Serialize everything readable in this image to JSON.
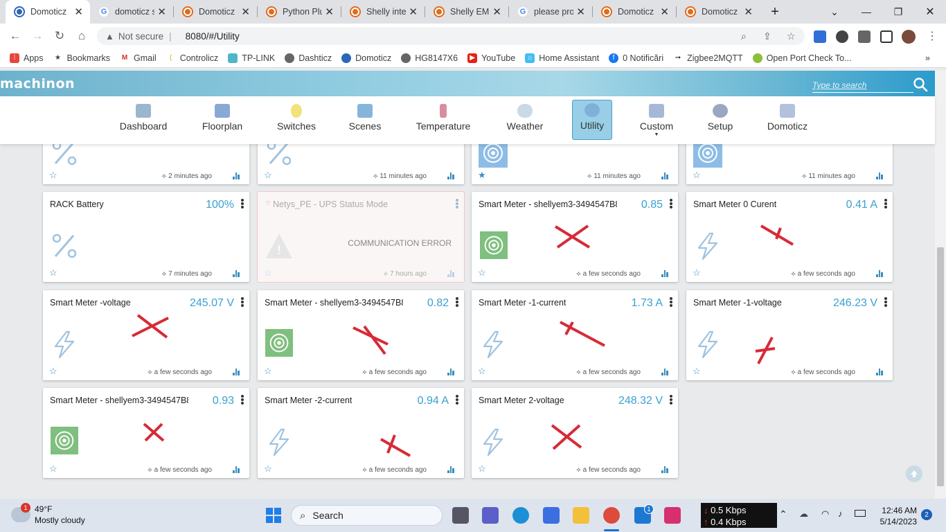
{
  "browser": {
    "tabs": [
      {
        "title": "Domoticz",
        "icon": "domoticz-blue",
        "active": true
      },
      {
        "title": "domoticz s",
        "icon": "google"
      },
      {
        "title": "Domoticz",
        "icon": "domoticz"
      },
      {
        "title": "Python Plu",
        "icon": "domoticz"
      },
      {
        "title": "Shelly inte",
        "icon": "domoticz"
      },
      {
        "title": "Shelly EM",
        "icon": "domoticz"
      },
      {
        "title": "please pro",
        "icon": "google"
      },
      {
        "title": "Domoticz",
        "icon": "domoticz"
      },
      {
        "title": "Domoticz",
        "icon": "domoticz"
      }
    ],
    "new_tab": "+",
    "omnibox": {
      "security": "Not secure",
      "url": "8080/#/Utility"
    },
    "bookmarks": [
      {
        "label": "Apps"
      },
      {
        "label": "Bookmarks"
      },
      {
        "label": "Gmail"
      },
      {
        "label": "Controlicz"
      },
      {
        "label": "TP-LINK"
      },
      {
        "label": "Dashticz"
      },
      {
        "label": "Domoticz"
      },
      {
        "label": "HG8147X6"
      },
      {
        "label": "YouTube"
      },
      {
        "label": "Home Assistant"
      },
      {
        "label": "0 Notificări"
      },
      {
        "label": "Zigbee2MQTT"
      },
      {
        "label": "Open Port Check To..."
      }
    ],
    "bookmarks_more": "»"
  },
  "app": {
    "logo": "machinon",
    "search_placeholder": "Type to search",
    "nav": [
      {
        "label": "Dashboard"
      },
      {
        "label": "Floorplan"
      },
      {
        "label": "Switches"
      },
      {
        "label": "Scenes"
      },
      {
        "label": "Temperature"
      },
      {
        "label": "Weather"
      },
      {
        "label": "Utility",
        "active": true
      },
      {
        "label": "Custom"
      },
      {
        "label": "Setup"
      },
      {
        "label": "Domoticz"
      }
    ]
  },
  "cards_top": [
    {
      "updated": "2 minutes ago",
      "icon": "percent",
      "favorite": false
    },
    {
      "updated": "11 minutes ago",
      "icon": "percent",
      "favorite": false
    },
    {
      "updated": "11 minutes ago",
      "icon": "target",
      "favorite": true
    },
    {
      "updated": "11 minutes ago",
      "icon": "target",
      "favorite": false
    }
  ],
  "cards": [
    {
      "name": "RACK Battery",
      "value": "100%",
      "updated": "7 minutes ago",
      "icon": "percent"
    },
    {
      "name": "Netys_PE - UPS Status Mode",
      "value": "",
      "status": "COMMUNICATION ERROR",
      "updated": "7 hours ago",
      "icon": "warning"
    },
    {
      "name": "Smart Meter - shellyem3-3494547B8E",
      "value": "0.85",
      "updated": "a few seconds ago",
      "icon": "target"
    },
    {
      "name": "Smart Meter 0 Curent",
      "value": "0.41 A",
      "updated": "a few seconds ago",
      "icon": "bolt"
    },
    {
      "name": "Smart Meter -voltage",
      "value": "245.07 V",
      "updated": "a few seconds ago",
      "icon": "bolt"
    },
    {
      "name": "Smart Meter - shellyem3-3494547B8E",
      "value": "0.82",
      "updated": "a few seconds ago",
      "icon": "target"
    },
    {
      "name": "Smart Meter -1-current",
      "value": "1.73 A",
      "updated": "a few seconds ago",
      "icon": "bolt"
    },
    {
      "name": "Smart Meter -1-voltage",
      "value": "246.23 V",
      "updated": "a few seconds ago",
      "icon": "bolt"
    },
    {
      "name": "Smart Meter - shellyem3-3494547B8E",
      "value": "0.93",
      "updated": "a few seconds ago",
      "icon": "target"
    },
    {
      "name": "Smart Meter -2-current",
      "value": "0.94 A",
      "updated": "a few seconds ago",
      "icon": "bolt"
    },
    {
      "name": "Smart Meter 2-voltage",
      "value": "248.32 V",
      "updated": "a few seconds ago",
      "icon": "bolt"
    }
  ],
  "taskbar": {
    "weather_badge": "1",
    "temperature": "49°F",
    "condition": "Mostly cloudy",
    "search_label": "Search",
    "mail_badge": "1",
    "net_down": "0.5 Kbps",
    "net_up": "0.4 Kbps",
    "time": "12:46 AM",
    "date": "5/14/2023",
    "notifications": "2"
  },
  "colors": {
    "accent": "#3aa0d0",
    "error": "#d62b37",
    "header": "#2b9bcb"
  }
}
